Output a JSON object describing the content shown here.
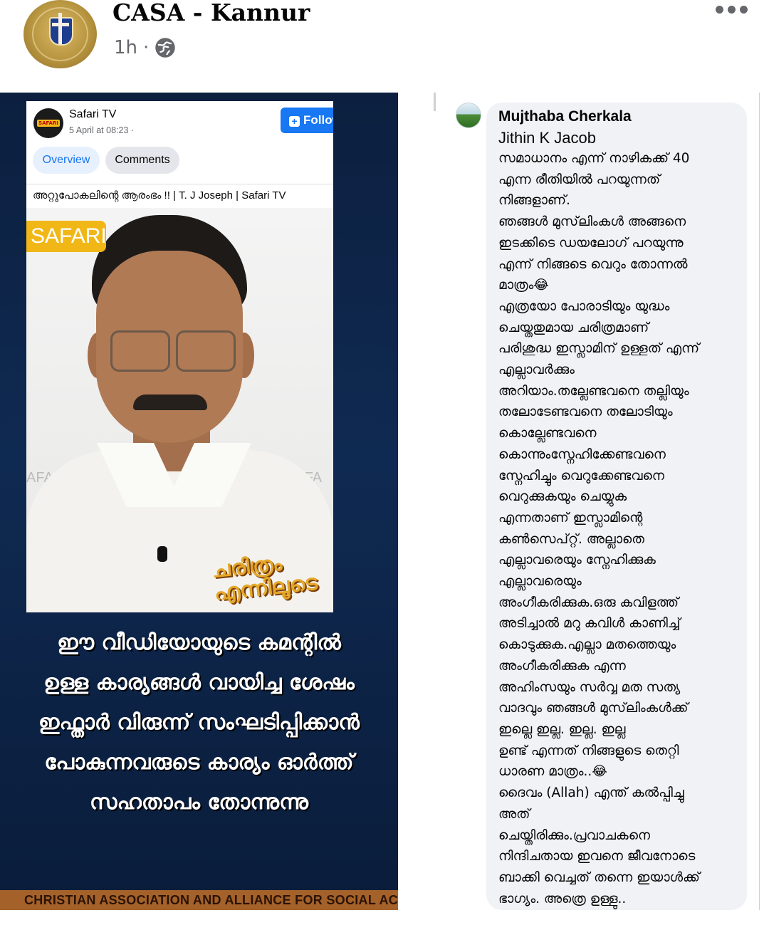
{
  "post": {
    "page_name": "CASA - Kannur",
    "timestamp": "1h",
    "separator": "·",
    "privacy_icon": "globe-icon",
    "menu_icon": "more-horizontal-icon"
  },
  "embedded_card": {
    "channel": "Safari TV",
    "date": "5 April at 08:23 ·",
    "logo_text": "SAFARI",
    "follow_label": "Follow",
    "tabs": [
      "Overview",
      "Comments"
    ],
    "video_title": "അറ്റുപോകലിന്റെ ആരംഭം !! | T. J Joseph | Safari TV",
    "badge": "SAFARI",
    "watermark_left": "AFARI  S",
    "watermark_right": "ARI  SAFA",
    "show_logo": "ചരിത്രം എന്നിലൂടെ"
  },
  "caption_lines": [
    "ഈ വീഡിയോയുടെ കമന്റിൽ",
    "ഉള്ള കാര്യങ്ങൾ വായിച്ച ശേഷം",
    "ഇഫ്താർ വിരുന്ന് സംഘടിപ്പിക്കാൻ",
    "പോകുന്നവരുടെ കാര്യം ഓർത്ത്",
    "സഹതാപം തോന്നുന്നു"
  ],
  "banner_text": "CHRISTIAN ASSOCIATION AND ALLIANCE FOR SOCIAL ACTION",
  "comment": {
    "author": "Mujthaba Cherkala",
    "mention": "Jithin K Jacob",
    "lines": [
      "സമാധാനം എന്ന് നാഴികക്ക് 40",
      "എന്ന രീതിയിൽ പറയുന്നത്",
      "നിങ്ങളാണ്.",
      "ഞങ്ങൾ മുസ്‌ലിംകൾ അങ്ങനെ",
      "ഇടക്കിടെ ഡയലോഗ് പറയുന്നു",
      "എന്ന് നിങ്ങടെ വെറും തോന്നൽ",
      "മാത്രം😂",
      "എത്രയോ പോരാടിയും യുദ്ധം",
      "ചെയ്തതുമായ ചരിത്രമാണ്",
      "പരിശുദ്ധ ഇസ്ലാമിന് ഉള്ളത് എന്ന്",
      "എല്ലാവർക്കും",
      "അറിയാം.തല്ലേണ്ടവനെ തല്ലിയും",
      "തലോടേണ്ടവനെ തലോടിയും",
      "കൊല്ലേണ്ടവനെ",
      "കൊന്നുംസ്നേഹിക്കേണ്ടവനെ",
      "സ്നേഹിച്ചും വെറുക്കേണ്ടവനെ",
      "വെറുക്കുകയും ചെയ്യുക",
      "എന്നതാണ് ഇസ്ലാമിന്റെ",
      "കൺസെപ്റ്റ്. അല്ലാതെ",
      "എല്ലാവരെയും സ്നേഹിക്കുക",
      "എല്ലാവരെയും",
      "അംഗീകരിക്കുക.ഒരു കവിളത്ത്",
      "അടിച്ചാൽ മറു കവിൾ കാണിച്ച്",
      "കൊടുക്കുക.എല്ലാ മതത്തെയും",
      "അംഗീകരിക്കുക എന്ന",
      "അഹിംസയും സർവ്വ മത സത്യ",
      "വാദവും ഞങ്ങൾ മുസ്‌ലിംകൾക്ക്",
      "ഇല്ലെ ഇല്ല. ഇല്ല. ഇല്ല",
      "ഉണ്ട് എന്നത് നിങ്ങളുടെ തെറ്റി",
      "ധാരണ മാത്രം..😂",
      "ദൈവം (Allah) എന്ത് കൽപ്പിച്ചു",
      "അത്",
      "ചെയ്തിരിക്കും.പ്രവാചകനെ",
      "നിന്ദിചതായ ഇവനെ ജീവനോടെ",
      "ബാക്കി വെച്ചത് തന്നെ ഇയാൾക്ക്",
      "ഭാഗ്യം. അത്രെ ഉള്ളു.."
    ]
  },
  "colors": {
    "accent": "#1877f2",
    "panel_dark": "#0f2a52",
    "bubble": "#f0f2f5",
    "banner": "#a4622a"
  }
}
